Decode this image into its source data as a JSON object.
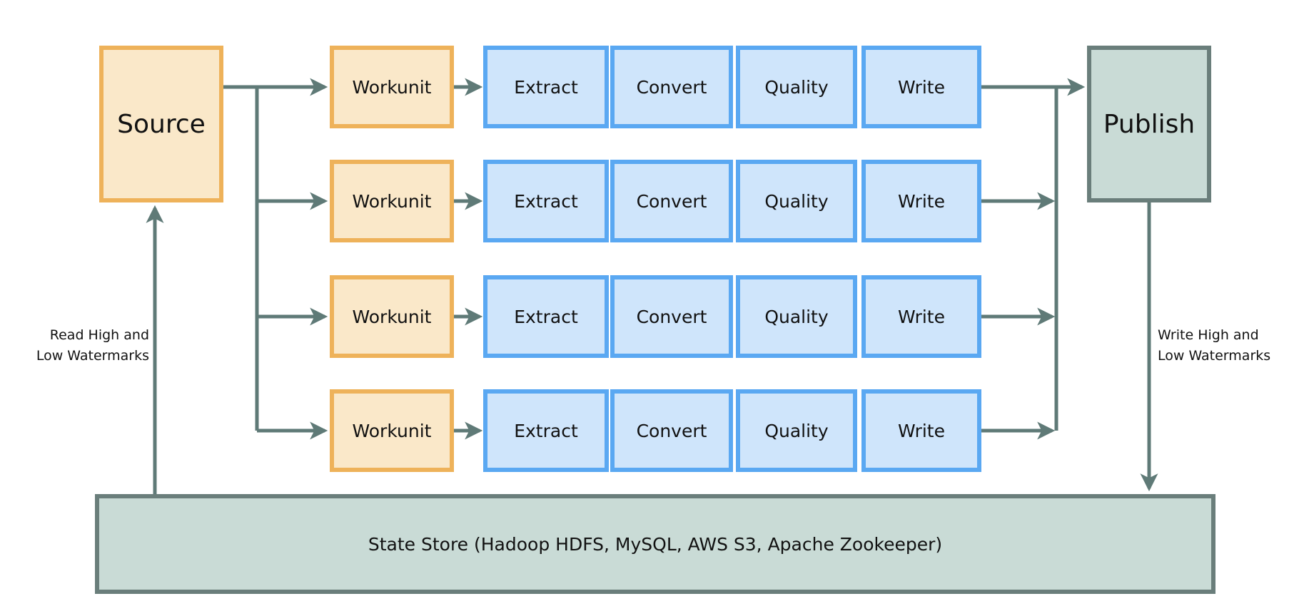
{
  "source": {
    "label": "Source"
  },
  "publish": {
    "label": "Publish"
  },
  "state_store": {
    "label": "State Store (Hadoop HDFS, MySQL, AWS S3, Apache Zookeeper)"
  },
  "rows": [
    {
      "workunit": "Workunit",
      "stages": [
        "Extract",
        "Convert",
        "Quality",
        "Write"
      ]
    },
    {
      "workunit": "Workunit",
      "stages": [
        "Extract",
        "Convert",
        "Quality",
        "Write"
      ]
    },
    {
      "workunit": "Workunit",
      "stages": [
        "Extract",
        "Convert",
        "Quality",
        "Write"
      ]
    },
    {
      "workunit": "Workunit",
      "stages": [
        "Extract",
        "Convert",
        "Quality",
        "Write"
      ]
    }
  ],
  "read_label": {
    "line1": "Read High and",
    "line2": "Low Watermarks"
  },
  "write_label": {
    "line1": "Write High and",
    "line2": "Low Watermarks"
  },
  "colors": {
    "arrow": "#5f7a77",
    "orange_border": "#eeb25a",
    "orange_fill": "#fae8c9",
    "blue_border": "#5aa8f2",
    "blue_fill": "#cfe5fb",
    "teal_border": "#6a7e7b",
    "teal_fill": "#c9dbd6"
  }
}
